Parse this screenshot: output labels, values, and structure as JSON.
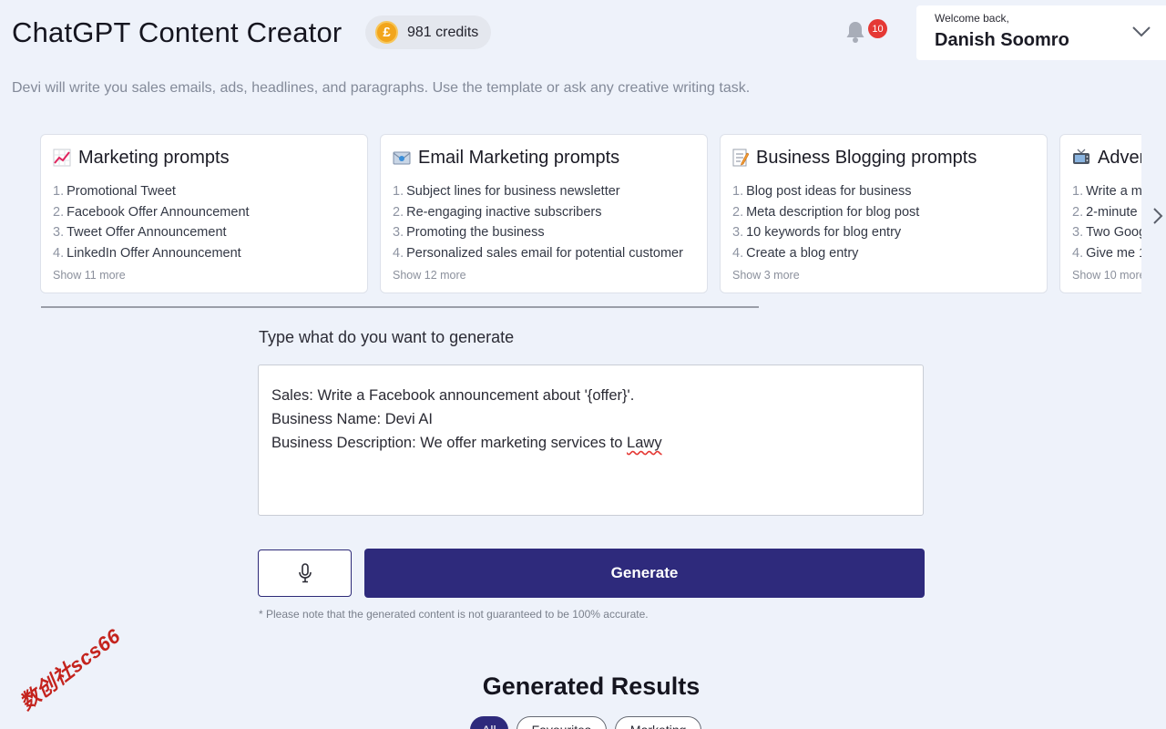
{
  "header": {
    "title": "ChatGPT Content Creator",
    "credits_symbol": "£",
    "credits_label": "981 credits",
    "notification_count": "10",
    "welcome": "Welcome back,",
    "user_name": "Danish Soomro"
  },
  "subtitle": "Devi will write you sales emails, ads, headlines, and paragraphs. Use the template or ask any creative writing task.",
  "cards": [
    {
      "icon": "chart-increasing-icon",
      "title": "Marketing prompts",
      "items": [
        {
          "num": "1.",
          "text": "Promotional Tweet"
        },
        {
          "num": "2.",
          "text": "Facebook Offer Announcement"
        },
        {
          "num": "3.",
          "text": "Tweet Offer Announcement"
        },
        {
          "num": "4.",
          "text": "LinkedIn Offer Announcement"
        }
      ],
      "more": "Show 11 more"
    },
    {
      "icon": "email-icon",
      "title": "Email Marketing prompts",
      "items": [
        {
          "num": "1.",
          "text": "Subject lines for business newsletter"
        },
        {
          "num": "2.",
          "text": "Re-engaging inactive subscribers"
        },
        {
          "num": "3.",
          "text": "Promoting the business"
        },
        {
          "num": "4.",
          "text": "Personalized sales email for potential customer"
        }
      ],
      "more": "Show 12 more"
    },
    {
      "icon": "memo-icon",
      "title": "Business Blogging prompts",
      "items": [
        {
          "num": "1.",
          "text": "Blog post ideas for business"
        },
        {
          "num": "2.",
          "text": "Meta description for blog post"
        },
        {
          "num": "3.",
          "text": "10 keywords for blog entry"
        },
        {
          "num": "4.",
          "text": "Create a blog entry"
        }
      ],
      "more": "Show 3 more"
    },
    {
      "icon": "television-icon",
      "title": "Adver",
      "items": [
        {
          "num": "1.",
          "text": "Write a mi"
        },
        {
          "num": "2.",
          "text": "2-minute"
        },
        {
          "num": "3.",
          "text": "Two Goog"
        },
        {
          "num": "4.",
          "text": "Give me 1"
        }
      ],
      "more": "Show 10 more"
    }
  ],
  "prompt": {
    "label": "Type what do you want to generate",
    "line1": "Sales: Write a Facebook announcement about '{offer}'.",
    "line2": "Business Name: Devi AI",
    "line3_prefix": "Business Description: We offer marketing services to ",
    "line3_misspelled": "Lawy"
  },
  "actions": {
    "generate_label": "Generate",
    "note": "* Please note that the generated content is not guaranteed to be 100% accurate."
  },
  "results": {
    "title": "Generated Results",
    "tabs": [
      "All",
      "Favourites",
      "Marketing"
    ]
  },
  "watermark": "数创社scs66",
  "colors": {
    "primary": "#2e2a7c",
    "background": "#eef2fa",
    "badge": "#e53935",
    "coin": "#f2a51c"
  }
}
